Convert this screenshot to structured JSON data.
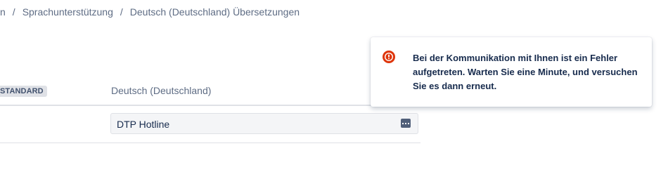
{
  "breadcrumb": {
    "items": [
      "n",
      "Sprachunterstützung",
      "Deutsch (Deutschland) Übersetzungen"
    ],
    "separator": "/"
  },
  "table": {
    "standard_badge": "STANDARD",
    "column_header": "Deutsch (Deutschland)",
    "rows": [
      {
        "translation_value": "DTP Hotline",
        "action_icon": "more-icon"
      }
    ]
  },
  "error_flag": {
    "icon": "error-icon",
    "message": "Bei der Kommunikation mit Ihnen ist ein Fehler aufgetreten. Warten Sie eine Minute, und versuchen Sie es dann erneut.",
    "color": "#de350b"
  }
}
